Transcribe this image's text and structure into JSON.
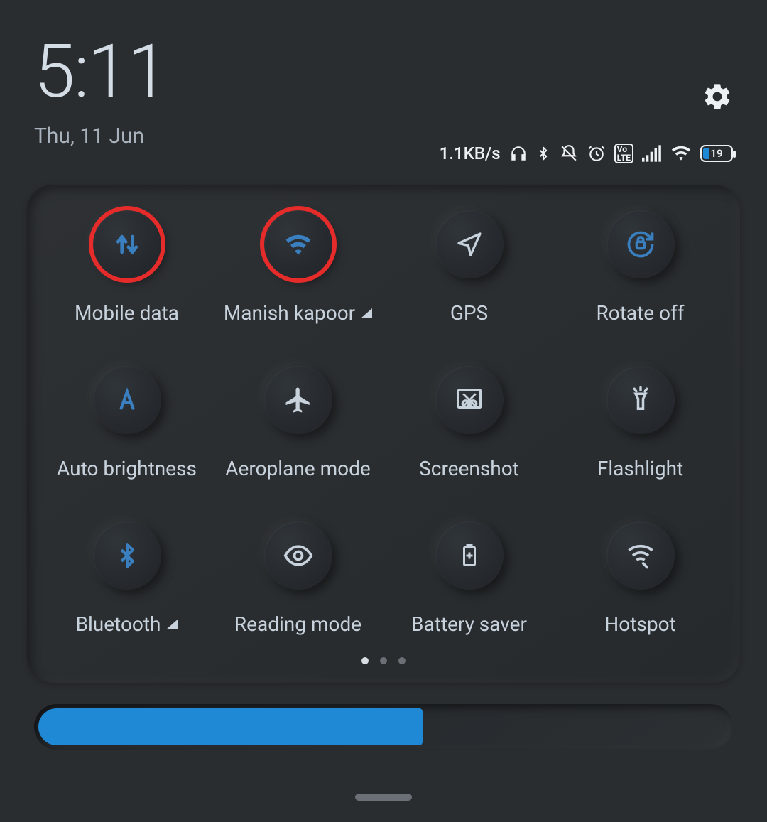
{
  "header": {
    "time": "5:11",
    "date": "Thu, 11 Jun"
  },
  "status": {
    "speed": "1.1KB/s",
    "battery_percent": "19",
    "volte": "Vo\nLTE"
  },
  "tiles": {
    "mobile_data": {
      "label": "Mobile data"
    },
    "wifi": {
      "label": "Manish kapoor"
    },
    "gps": {
      "label": "GPS"
    },
    "rotate": {
      "label": "Rotate off"
    },
    "auto_brightness": {
      "label": "Auto brightness"
    },
    "aeroplane": {
      "label": "Aeroplane mode"
    },
    "screenshot": {
      "label": "Screenshot"
    },
    "flashlight": {
      "label": "Flashlight"
    },
    "bluetooth": {
      "label": "Bluetooth"
    },
    "reading": {
      "label": "Reading mode"
    },
    "battery_saver": {
      "label": "Battery saver"
    },
    "hotspot": {
      "label": "Hotspot"
    }
  },
  "pager": {
    "current": 1,
    "total": 3
  },
  "brightness_percent": 55,
  "colors": {
    "accent": "#1f89d6",
    "active_icon": "#3a7fbf",
    "icon": "#c8d2dc",
    "highlight_ring": "#e62b2b"
  }
}
